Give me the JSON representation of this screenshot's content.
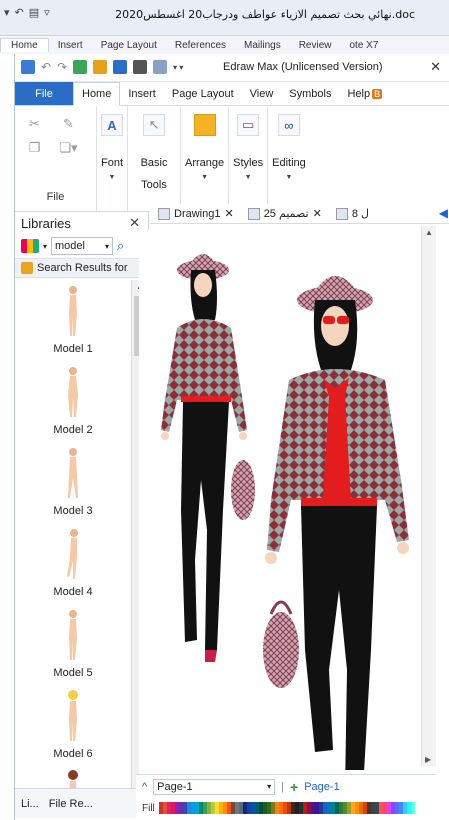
{
  "word": {
    "title": "نهائي بحث تصميم الازياء عواطف ودرجاب20 اغسطس2020.doc",
    "tabs": [
      "Home",
      "Insert",
      "Page Layout",
      "References",
      "Mailings",
      "Review",
      "ote X7"
    ]
  },
  "edraw": {
    "title": "Edraw Max (Unlicensed Version)",
    "close": "✕",
    "menu": {
      "file": "File",
      "items": [
        "Home",
        "Insert",
        "Page Layout",
        "View",
        "Symbols"
      ],
      "help": "Help",
      "help_badge": "B"
    },
    "ribbon": {
      "file_group_label": "File",
      "buttons": [
        {
          "label": "Font",
          "icon": "font-icon"
        },
        {
          "label": "Basic Tools",
          "icon": "pointer-icon"
        },
        {
          "label": "Arrange",
          "icon": "arrange-icon"
        },
        {
          "label": "Styles",
          "icon": "styles-icon"
        },
        {
          "label": "Editing",
          "icon": "binoculars-icon"
        }
      ]
    },
    "libraries": {
      "title": "Libraries",
      "close": "✕",
      "search_value": "model",
      "results_label": "Search Results for",
      "models": [
        "Model 1",
        "Model 2",
        "Model 3",
        "Model 4",
        "Model 5",
        "Model 6"
      ],
      "bottom_tabs": [
        "Li...",
        "File Re..."
      ]
    },
    "doc_tabs": [
      "Drawing1",
      "تصميم 25",
      "8 ل"
    ],
    "page": {
      "selector": "Page-1",
      "tab": "Page-1",
      "fill_label": "Fill"
    }
  }
}
